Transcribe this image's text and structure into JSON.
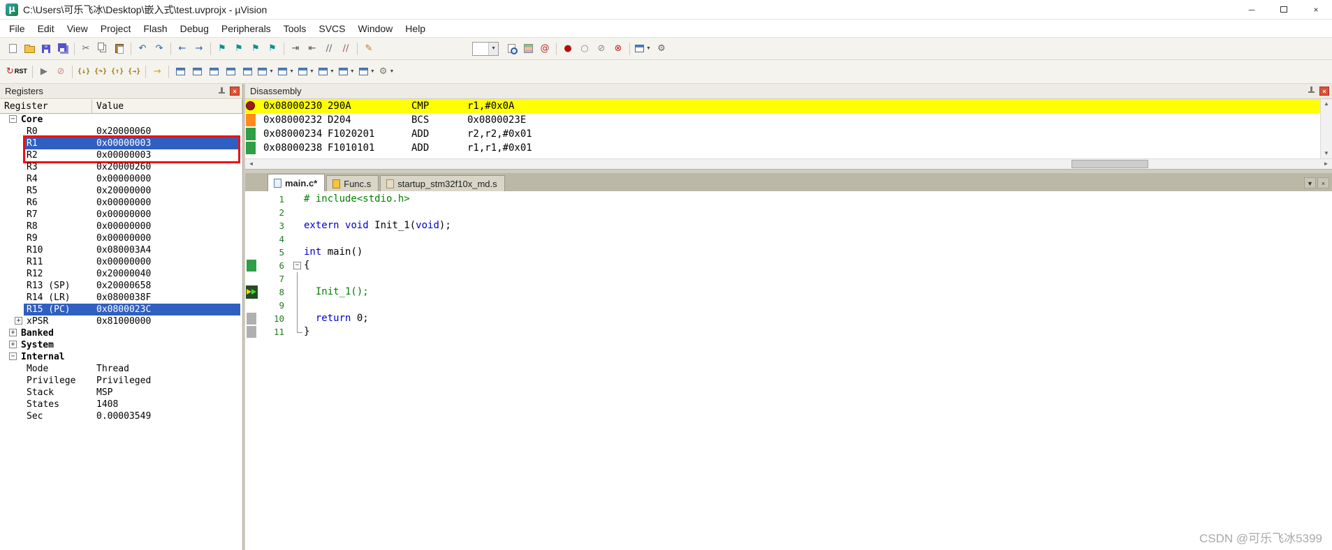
{
  "window": {
    "title": "C:\\Users\\可乐飞冰\\Desktop\\嵌入式\\test.uvprojx - µVision",
    "logo_glyph": "µ"
  },
  "chrome": {
    "minimize": "─",
    "close": "×",
    "caret": "▼",
    "scroll_up": "▲",
    "scroll_down": "▼",
    "scroll_left": "◄",
    "scroll_right": "►"
  },
  "menu": {
    "items": [
      "File",
      "Edit",
      "View",
      "Project",
      "Flash",
      "Debug",
      "Peripherals",
      "Tools",
      "SVCS",
      "Window",
      "Help"
    ]
  },
  "toolbar_main": {
    "items": [
      {
        "name": "new-file-icon",
        "shape": "page"
      },
      {
        "name": "open-file-icon",
        "shape": "folder"
      },
      {
        "name": "save-icon",
        "shape": "disk"
      },
      {
        "name": "save-all-icon",
        "shape": "disks"
      },
      {
        "sep": true
      },
      {
        "name": "cut-icon",
        "glyph": "✂",
        "color": "#666666"
      },
      {
        "name": "copy-icon",
        "shape": "copy"
      },
      {
        "name": "paste-icon",
        "shape": "paste"
      },
      {
        "sep": true
      },
      {
        "name": "undo-icon",
        "glyph": "↶",
        "color": "#2a5fb0"
      },
      {
        "name": "redo-icon",
        "glyph": "↷",
        "color": "#2a5fb0"
      },
      {
        "sep": true
      },
      {
        "name": "navigate-back-icon",
        "glyph": "←",
        "color": "#2a5fb0"
      },
      {
        "name": "navigate-forward-icon",
        "glyph": "→",
        "color": "#2a5fb0"
      },
      {
        "sep": true
      },
      {
        "name": "toggle-bookmark-icon",
        "glyph": "⚑",
        "color": "#0e8f8f"
      },
      {
        "name": "prev-bookmark-icon",
        "glyph": "⚑",
        "color": "#0e8f8f"
      },
      {
        "name": "next-bookmark-icon",
        "glyph": "⚑",
        "color": "#0e8f8f"
      },
      {
        "name": "clear-bookmarks-icon",
        "glyph": "⚑",
        "color": "#0e8f8f"
      },
      {
        "sep": true
      },
      {
        "name": "indent-icon",
        "glyph": "⇥",
        "color": "#555555"
      },
      {
        "name": "unindent-icon",
        "glyph": "⇤",
        "color": "#555555"
      },
      {
        "name": "comment-icon",
        "glyph": "∕∕",
        "color": "#556677"
      },
      {
        "name": "uncomment-icon",
        "glyph": "∕∕",
        "color": "#995555"
      },
      {
        "sep": true
      },
      {
        "name": "configure-editor-icon",
        "glyph": "✎",
        "color": "#c07820"
      },
      {
        "space": true
      },
      {
        "combo": true,
        "name": "target-select-combo"
      },
      {
        "name": "find-in-files-icon",
        "shape": "magpage"
      },
      {
        "name": "manage-rte-icon",
        "shape": "rte"
      },
      {
        "name": "lookup-icon",
        "glyph": "@",
        "color": "#c42020"
      },
      {
        "sep": true
      },
      {
        "name": "toggle-breakpoint-icon",
        "glyph": "●",
        "color": "#b01010"
      },
      {
        "name": "disable-breakpoint-icon",
        "glyph": "○",
        "color": "#888888"
      },
      {
        "name": "disable-all-breakpoints-icon",
        "glyph": "⊘",
        "color": "#888888"
      },
      {
        "name": "kill-all-breakpoints-icon",
        "glyph": "⊗",
        "color": "#c42020"
      },
      {
        "sep": true
      },
      {
        "name": "window-layout-dropdown",
        "shape": "window",
        "caret": true
      },
      {
        "name": "configure-uvision-icon",
        "glyph": "⚙",
        "color": "#666666"
      }
    ]
  },
  "toolbar_debug": {
    "items": [
      {
        "name": "reset-button",
        "glyph": "↻",
        "color": "#c02020",
        "label": "RST"
      },
      {
        "sep": true
      },
      {
        "name": "run-button",
        "glyph": "▶",
        "color": "#777777"
      },
      {
        "name": "stop-button",
        "glyph": "⊘",
        "color": "#cc8888"
      },
      {
        "sep": true
      },
      {
        "name": "step-button",
        "glyph": "{↓}",
        "color": "#a0760a",
        "small": true
      },
      {
        "name": "step-over-button",
        "glyph": "{↷}",
        "color": "#a0760a",
        "small": true
      },
      {
        "name": "step-out-button",
        "glyph": "{↑}",
        "color": "#a0760a",
        "small": true
      },
      {
        "name": "run-to-line-button",
        "glyph": "{→}",
        "color": "#a0760a",
        "small": true
      },
      {
        "sep": true
      },
      {
        "name": "show-next-statement-button",
        "glyph": "→",
        "color": "#e0a000"
      },
      {
        "sep": true
      },
      {
        "name": "command-window-button",
        "shape": "window"
      },
      {
        "name": "disassembly-window-button",
        "shape": "window"
      },
      {
        "name": "symbol-window-button",
        "shape": "window"
      },
      {
        "name": "registers-window-button",
        "shape": "window"
      },
      {
        "name": "call-stack-window-button",
        "shape": "window"
      },
      {
        "name": "watch-window-button",
        "shape": "window",
        "caret": true
      },
      {
        "name": "memory-window-button",
        "shape": "window",
        "caret": true
      },
      {
        "name": "serial-window-button",
        "shape": "window",
        "caret": true
      },
      {
        "name": "analysis-window-button",
        "shape": "window",
        "caret": true
      },
      {
        "name": "trace-window-button",
        "shape": "window",
        "caret": true
      },
      {
        "name": "system-viewer-button",
        "shape": "window",
        "caret": true
      },
      {
        "name": "toolbox-button",
        "glyph": "⚙",
        "color": "#777777",
        "caret": true
      }
    ]
  },
  "registers_panel": {
    "title": "Registers",
    "columns": [
      "Register",
      "Value"
    ],
    "rows": [
      {
        "label": "Core",
        "level": 0,
        "expander": "minus",
        "bold": true
      },
      {
        "label": "R0",
        "level": 1,
        "value": "0x20000060"
      },
      {
        "label": "R1",
        "level": 1,
        "value": "0x00000003",
        "selected": true
      },
      {
        "label": "R2",
        "level": 1,
        "value": "0x00000003"
      },
      {
        "label": "R3",
        "level": 1,
        "value": "0x20000260"
      },
      {
        "label": "R4",
        "level": 1,
        "value": "0x00000000"
      },
      {
        "label": "R5",
        "level": 1,
        "value": "0x20000000"
      },
      {
        "label": "R6",
        "level": 1,
        "value": "0x00000000"
      },
      {
        "label": "R7",
        "level": 1,
        "value": "0x00000000"
      },
      {
        "label": "R8",
        "level": 1,
        "value": "0x00000000"
      },
      {
        "label": "R9",
        "level": 1,
        "value": "0x00000000"
      },
      {
        "label": "R10",
        "level": 1,
        "value": "0x080003A4"
      },
      {
        "label": "R11",
        "level": 1,
        "value": "0x00000000"
      },
      {
        "label": "R12",
        "level": 1,
        "value": "0x20000040"
      },
      {
        "label": "R13 (SP)",
        "level": 1,
        "value": "0x20000658"
      },
      {
        "label": "R14 (LR)",
        "level": 1,
        "value": "0x0800038F"
      },
      {
        "label": "R15 (PC)",
        "level": 1,
        "value": "0x0800023C",
        "selected": true
      },
      {
        "label": "xPSR",
        "level": 1,
        "value": "0x81000000",
        "expander": "plus"
      },
      {
        "label": "Banked",
        "level": 0,
        "expander": "plus",
        "bold": true
      },
      {
        "label": "System",
        "level": 0,
        "expander": "plus",
        "bold": true
      },
      {
        "label": "Internal",
        "level": 0,
        "expander": "minus",
        "bold": true
      },
      {
        "label": "Mode",
        "level": 1,
        "value": "Thread"
      },
      {
        "label": "Privilege",
        "level": 1,
        "value": "Privileged"
      },
      {
        "label": "Stack",
        "level": 1,
        "value": "MSP"
      },
      {
        "label": "States",
        "level": 1,
        "value": "1408"
      },
      {
        "label": "Sec",
        "level": 1,
        "value": "0.00003549"
      }
    ]
  },
  "disassembly": {
    "title": "Disassembly",
    "lines": [
      {
        "gutter": "breakpoint",
        "current": true,
        "address": "0x08000230",
        "bytes": "290A",
        "mnemonic": "CMP",
        "operands": "r1,#0x0A"
      },
      {
        "gutter": "orange",
        "address": "0x08000232",
        "bytes": "D204",
        "mnemonic": "BCS",
        "operands": "0x0800023E"
      },
      {
        "gutter": "green",
        "address": "0x08000234",
        "bytes": "F1020201",
        "mnemonic": "ADD",
        "operands": "r2,r2,#0x01"
      },
      {
        "gutter": "green",
        "address": "0x08000238",
        "bytes": "F1010101",
        "mnemonic": "ADD",
        "operands": "r1,r1,#0x01"
      }
    ]
  },
  "editor": {
    "tabs": [
      {
        "label": "main.c*",
        "icon": "c-file",
        "active": true
      },
      {
        "label": "Func.s",
        "icon": "asm-file",
        "active": false
      },
      {
        "label": "startup_stm32f10x_md.s",
        "icon": "asm-file2",
        "active": false
      }
    ],
    "lines": [
      {
        "num": 1,
        "segments": [
          [
            "pre",
            "# include<stdio.h>"
          ]
        ]
      },
      {
        "num": 2,
        "segments": []
      },
      {
        "num": 3,
        "segments": [
          [
            "kw",
            "extern"
          ],
          [
            "pl",
            " "
          ],
          [
            "kw",
            "void"
          ],
          [
            "pl",
            " Init_1("
          ],
          [
            "kw",
            "void"
          ],
          [
            "pl",
            ");"
          ]
        ]
      },
      {
        "num": 4,
        "segments": []
      },
      {
        "num": 5,
        "segments": [
          [
            "kw",
            "int"
          ],
          [
            "pl",
            " main()"
          ]
        ]
      },
      {
        "num": 6,
        "segments": [
          [
            "pl",
            "{"
          ]
        ],
        "fold": "open",
        "gutter": "green"
      },
      {
        "num": 7,
        "segments": [],
        "fold": "line"
      },
      {
        "num": 8,
        "segments": [
          [
            "fn",
            "  Init_1();"
          ]
        ],
        "fold": "line",
        "gutter": "current"
      },
      {
        "num": 9,
        "segments": [],
        "fold": "line"
      },
      {
        "num": 10,
        "segments": [
          [
            "kw",
            "  return"
          ],
          [
            "pl",
            " 0;"
          ]
        ],
        "fold": "line",
        "gutter": "gray"
      },
      {
        "num": 11,
        "segments": [
          [
            "pl",
            "}"
          ]
        ],
        "fold": "end",
        "gutter": "gray"
      }
    ]
  },
  "watermark": "CSDN @可乐飞冰5399"
}
